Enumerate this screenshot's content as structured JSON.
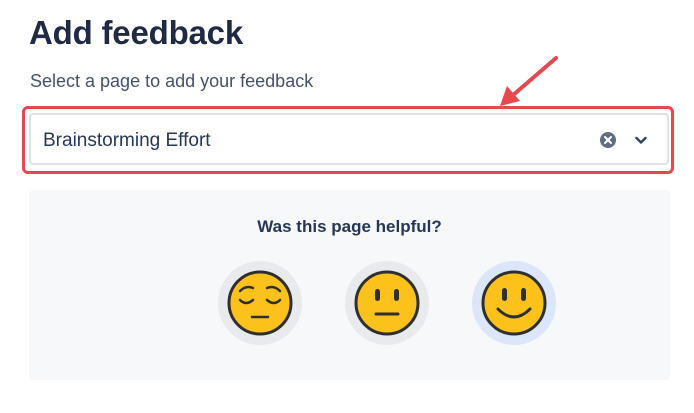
{
  "header": {
    "title": "Add feedback",
    "subtitle": "Select a page to add your feedback"
  },
  "page_select": {
    "value": "Brainstorming Effort",
    "clear_icon": "clear-icon",
    "dropdown_icon": "chevron-down-icon"
  },
  "feedback": {
    "question": "Was this page helpful?",
    "options": [
      {
        "icon": "pensive-face-icon",
        "selected": false
      },
      {
        "icon": "neutral-face-icon",
        "selected": false
      },
      {
        "icon": "smiling-face-icon",
        "selected": true
      }
    ]
  },
  "colors": {
    "highlight": "#e5484d",
    "emoji_fill": "#fcc21b",
    "selected_bg": "#dbe6fb",
    "panel_bg": "#f7f8fa"
  }
}
